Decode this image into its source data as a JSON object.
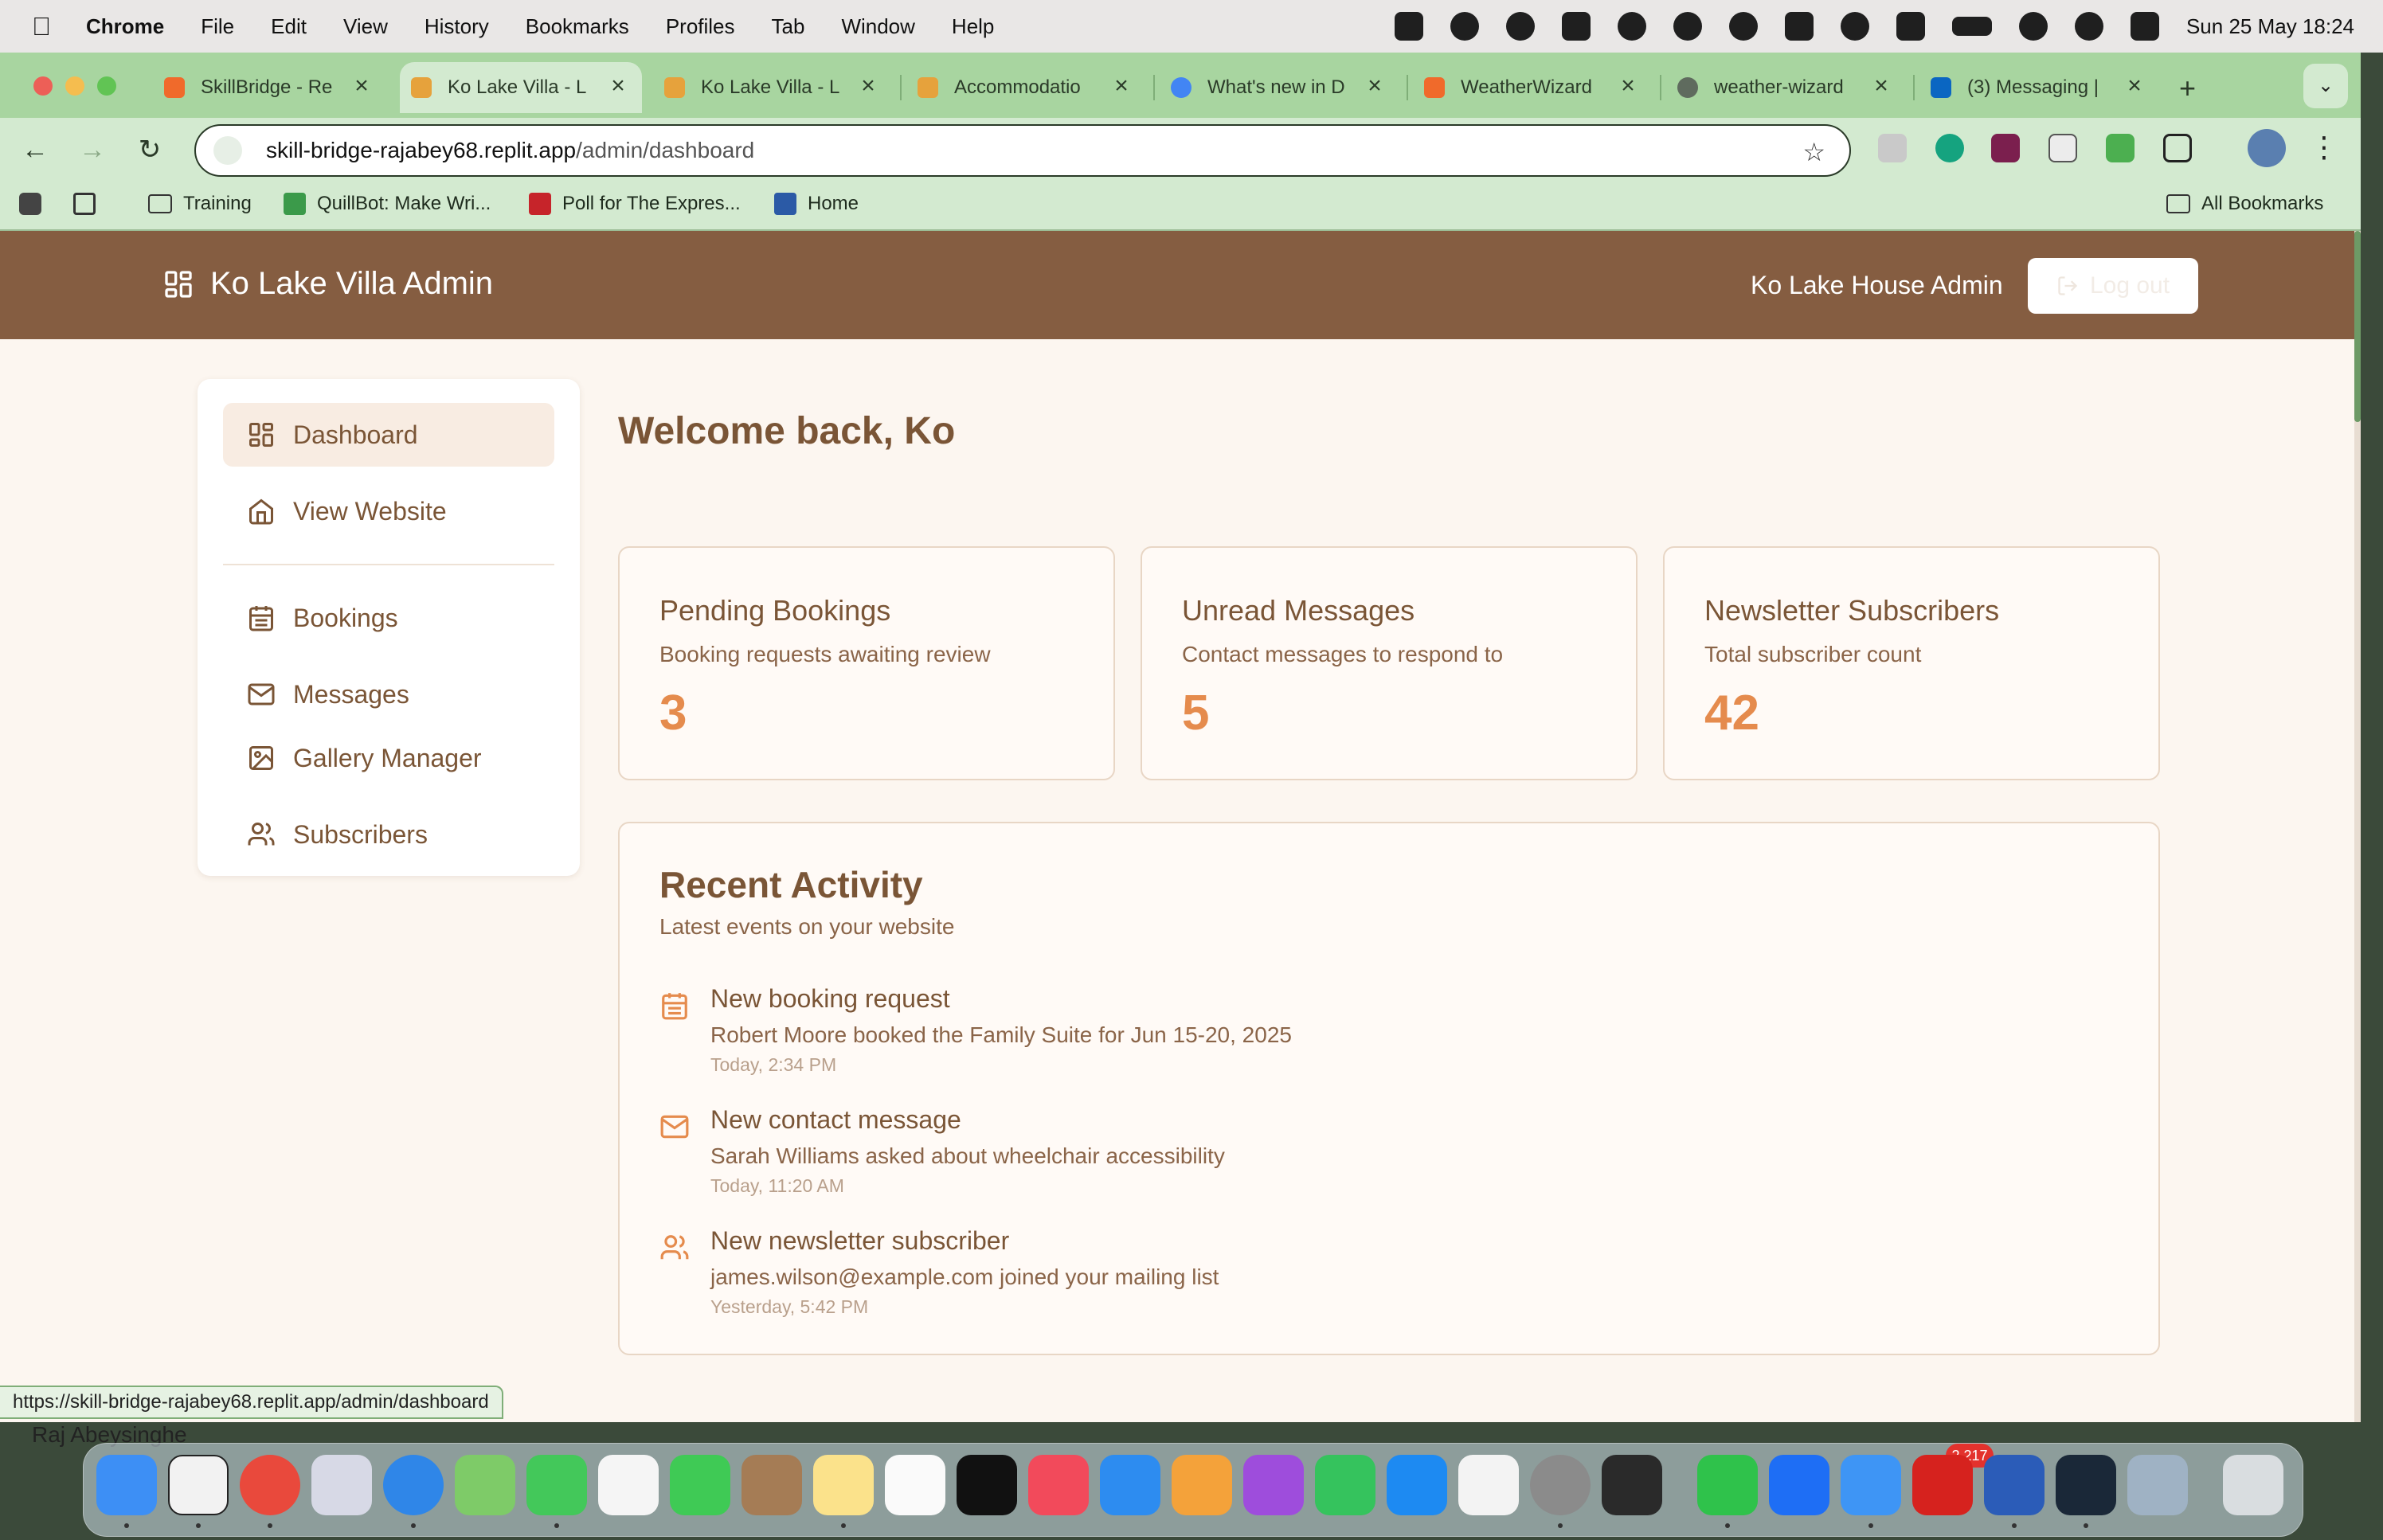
{
  "menubar": {
    "app": "Chrome",
    "items": [
      "File",
      "Edit",
      "View",
      "History",
      "Bookmarks",
      "Profiles",
      "Tab",
      "Window",
      "Help"
    ],
    "clock": "Sun 25 May  18:24"
  },
  "tabs": [
    {
      "title": "SkillBridge - Re",
      "color": "#f06a2b"
    },
    {
      "title": "Ko Lake Villa - L",
      "color": "#e6a23c",
      "active": true
    },
    {
      "title": "Ko Lake Villa - L",
      "color": "#e6a23c"
    },
    {
      "title": "Accommodatio",
      "color": "#e6a23c"
    },
    {
      "title": "What's new in D",
      "color": "#4285f4"
    },
    {
      "title": "WeatherWizard",
      "color": "#f06a2b"
    },
    {
      "title": "weather-wizard",
      "color": "#5f6b5e"
    },
    {
      "title": "(3) Messaging |",
      "color": "#0a66c2"
    }
  ],
  "toolbar": {
    "url_host": "skill-bridge-rajabey68.replit.app",
    "url_path": "/admin/dashboard"
  },
  "bookmarks": {
    "items": [
      "Training",
      "QuillBot: Make Wri...",
      "Poll for The Expres...",
      "Home"
    ],
    "all": "All Bookmarks"
  },
  "app": {
    "brand": "Ko Lake Villa Admin",
    "admin_name": "Ko Lake House Admin",
    "logout": "Log out",
    "welcome": "Welcome back, Ko"
  },
  "sidebar": {
    "items": [
      {
        "label": "Dashboard",
        "icon": "dashboard-icon",
        "active": true
      },
      {
        "label": "View Website",
        "icon": "home-icon"
      },
      {
        "label": "Bookings",
        "icon": "calendar-icon"
      },
      {
        "label": "Messages",
        "icon": "mail-icon"
      },
      {
        "label": "Gallery Manager",
        "icon": "image-icon"
      },
      {
        "label": "Subscribers",
        "icon": "users-icon"
      }
    ]
  },
  "stats": [
    {
      "title": "Pending Bookings",
      "desc": "Booking requests awaiting review",
      "value": "3"
    },
    {
      "title": "Unread Messages",
      "desc": "Contact messages to respond to",
      "value": "5"
    },
    {
      "title": "Newsletter Subscribers",
      "desc": "Total subscriber count",
      "value": "42"
    }
  ],
  "activity": {
    "title": "Recent Activity",
    "subtitle": "Latest events on your website",
    "items": [
      {
        "icon": "calendar-icon",
        "title": "New booking request",
        "detail": "Robert Moore booked the Family Suite for Jun 15-20, 2025",
        "when": "Today, 2:34 PM"
      },
      {
        "icon": "mail-icon",
        "title": "New contact message",
        "detail": "Sarah Williams asked about wheelchair accessibility",
        "when": "Today, 11:20 AM"
      },
      {
        "icon": "users-icon",
        "title": "New newsletter subscriber",
        "detail": "james.wilson@example.com joined your mailing list",
        "when": "Yesterday, 5:42 PM"
      }
    ]
  },
  "statusbar": "https://skill-bridge-rajabey68.replit.app/admin/dashboard",
  "behind_window": "Raj Abeysinghe",
  "dock": {
    "mail_badge": "2,217"
  },
  "colors": {
    "header": "#855d41",
    "accent": "#e58b4d",
    "text_brown": "#7a5536",
    "chrome_green": "#a8d5a0"
  }
}
